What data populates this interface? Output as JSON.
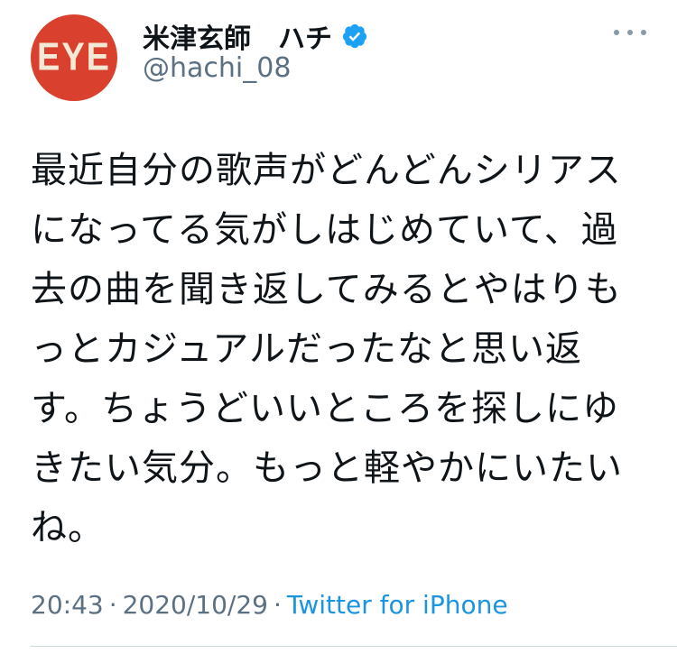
{
  "author": {
    "avatar_text": "EYE",
    "display_name": "米津玄師　ハチ",
    "handle": "@hachi_08",
    "verified": true
  },
  "tweet": {
    "text": "最近自分の歌声がどんどんシリアスになってる気がしはじめていて、過去の曲を聞き返してみるとやはりもっとカジュアルだったなと思い返す。ちょうどいいところを探しにゆきたい気分。もっと軽やかにいたいね。",
    "time": "20:43",
    "date": "2020/10/29",
    "separator": "·",
    "source": "Twitter for iPhone"
  },
  "icons": {
    "verified": "verified-badge-icon",
    "more": "more-options-icon"
  },
  "colors": {
    "avatar_bg": "#d9402d",
    "verified": "#1da1f2",
    "link": "#1b95e0",
    "secondary_text": "#5b7083"
  }
}
